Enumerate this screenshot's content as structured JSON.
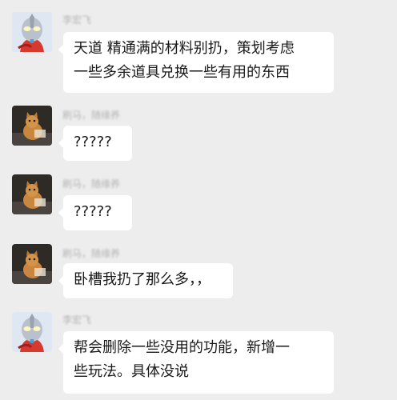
{
  "conversation": {
    "messages": [
      {
        "sender": "李宏飞",
        "avatar_icon": "ultraman-avatar-icon",
        "lines": [
          "天道 精通满的材料别扔，策划考虑",
          "一些多余道具兑换一些有用的东西"
        ]
      },
      {
        "sender": "刷马，随缘养",
        "avatar_icon": "cat-avatar-icon",
        "lines": [
          "?????"
        ]
      },
      {
        "sender": "刷马，随缘养",
        "avatar_icon": "cat-avatar-icon",
        "lines": [
          "?????"
        ]
      },
      {
        "sender": "刷马，随缘养",
        "avatar_icon": "cat-avatar-icon",
        "lines": [
          "卧槽我扔了那么多，，"
        ]
      },
      {
        "sender": "李宏飞",
        "avatar_icon": "ultraman-avatar-icon",
        "lines": [
          "帮会删除一些没用的功能，新增一",
          "些玩法。具体没说"
        ]
      }
    ]
  },
  "colors": {
    "background": "#ededed",
    "bubble": "#ffffff",
    "text": "#191919",
    "sender_name": "#b5b5b5"
  }
}
